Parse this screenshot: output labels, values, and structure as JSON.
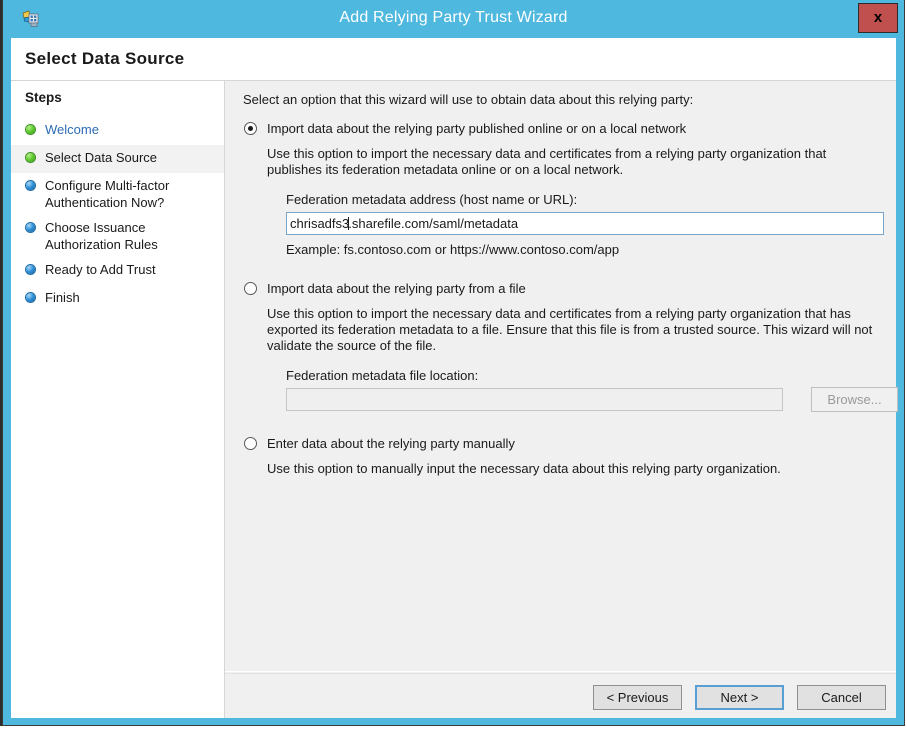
{
  "window": {
    "title": "Add Relying Party Trust Wizard",
    "icon": "adfs-wizard-icon",
    "close_label": "x",
    "accent_color": "#4FB8DF",
    "close_color": "#c0504d"
  },
  "header": {
    "title": "Select Data Source"
  },
  "sidebar": {
    "title": "Steps",
    "items": [
      {
        "label": "Welcome",
        "bullet": "green",
        "state": "link",
        "selected": false
      },
      {
        "label": "Select Data Source",
        "bullet": "green",
        "state": "current",
        "selected": true
      },
      {
        "label": "Configure Multi-factor Authentication Now?",
        "bullet": "blue",
        "state": "pending",
        "selected": false
      },
      {
        "label": "Choose Issuance Authorization Rules",
        "bullet": "blue",
        "state": "pending",
        "selected": false
      },
      {
        "label": "Ready to Add Trust",
        "bullet": "blue",
        "state": "pending",
        "selected": false
      },
      {
        "label": "Finish",
        "bullet": "blue",
        "state": "pending",
        "selected": false
      }
    ]
  },
  "main": {
    "intro": "Select an option that this wizard will use to obtain data about this relying party:",
    "options": [
      {
        "label": "Import data about the relying party published online or on a local network",
        "checked": true,
        "description": "Use this option to import the necessary data and certificates from a relying party organization that publishes its federation metadata online or on a local network.",
        "field_label": "Federation metadata address (host name or URL):",
        "field_value_before_caret": "chrisadfs3",
        "field_value_after_caret": ".sharefile.com/saml/metadata",
        "field_value": "chrisadfs3.sharefile.com/saml/metadata",
        "field_placeholder": "",
        "example": "Example: fs.contoso.com or https://www.contoso.com/app"
      },
      {
        "label": "Import data about the relying party from a file",
        "checked": false,
        "description": "Use this option to import the necessary data and certificates from a relying party organization that has exported its federation metadata to a file. Ensure that this file is from a trusted source.  This wizard will not validate the source of the file.",
        "field_label": "Federation metadata file location:",
        "field_value": "",
        "field_placeholder": "",
        "browse_label": "Browse...",
        "disabled": true
      },
      {
        "label": "Enter data about the relying party manually",
        "checked": false,
        "description": "Use this option to manually input the necessary data about this relying party organization."
      }
    ]
  },
  "footer": {
    "previous_label": "< Previous",
    "next_label": "Next >",
    "cancel_label": "Cancel"
  }
}
